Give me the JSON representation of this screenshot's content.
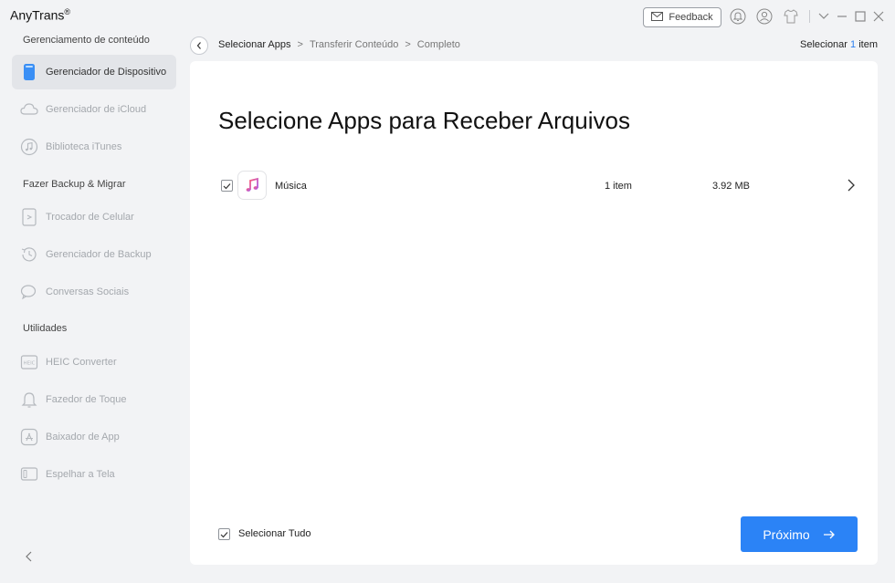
{
  "app": {
    "title": "AnyTrans",
    "reg": "®"
  },
  "topbar": {
    "feedback_label": "Feedback"
  },
  "sidebar": {
    "sections": [
      {
        "title": "Gerenciamento de conteúdo"
      },
      {
        "title": "Fazer Backup & Migrar"
      },
      {
        "title": "Utilidades"
      }
    ],
    "items": [
      {
        "label": "Gerenciador de Dispositivo",
        "icon": "device-icon",
        "active": true
      },
      {
        "label": "Gerenciador de iCloud",
        "icon": "cloud-icon"
      },
      {
        "label": "Biblioteca iTunes",
        "icon": "music-note-icon"
      },
      {
        "label": "Trocador de Celular",
        "icon": "phone-switch-icon"
      },
      {
        "label": "Gerenciador de Backup",
        "icon": "backup-clock-icon"
      },
      {
        "label": "Conversas Sociais",
        "icon": "chat-icon"
      },
      {
        "label": "HEIC Converter",
        "icon": "heic-icon"
      },
      {
        "label": "Fazedor de Toque",
        "icon": "bell-icon"
      },
      {
        "label": "Baixador de App",
        "icon": "app-store-icon"
      },
      {
        "label": "Espelhar a Tela",
        "icon": "mirror-icon"
      }
    ]
  },
  "breadcrumb": {
    "steps": [
      "Selecionar Apps",
      "Transferir Conteúdo",
      "Completo"
    ],
    "sep": ">"
  },
  "selection": {
    "prefix": "Selecionar ",
    "count": "1",
    "suffix": " item"
  },
  "main": {
    "title": "Selecione Apps para Receber Arquivos",
    "rows": [
      {
        "name": "Música",
        "count": "1 item",
        "size": "3.92 MB",
        "checked": true
      }
    ],
    "select_all_label": "Selecionar Tudo",
    "next_label": "Próximo"
  },
  "colors": {
    "accent": "#2b83f6",
    "bg": "#f2f3f5",
    "panel": "#ffffff"
  }
}
